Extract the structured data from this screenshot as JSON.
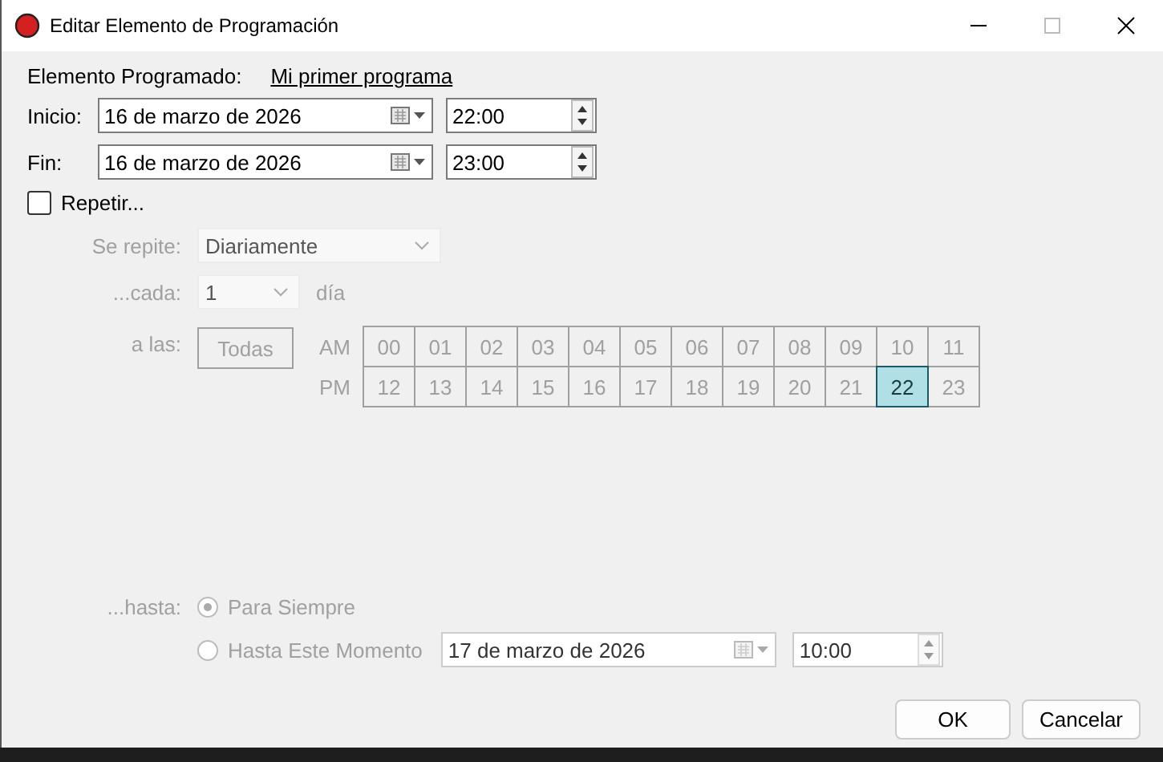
{
  "window": {
    "title": "Editar Elemento de Programación"
  },
  "program": {
    "label": "Elemento Programado:",
    "link": "Mi primer programa"
  },
  "start": {
    "label": "Inicio:",
    "date": "16 de marzo de 2026",
    "time": "22:00"
  },
  "end": {
    "label": "Fin:",
    "date": "16 de marzo de 2026",
    "time": "23:00"
  },
  "repeat": {
    "label": "Repetir...",
    "checked": false,
    "frequency": {
      "label": "Se repite:",
      "value": "Diariamente"
    },
    "every": {
      "label": "...cada:",
      "value": "1",
      "unit": "día"
    },
    "at": {
      "label": "a las:",
      "all_button": "Todas",
      "am_label": "AM",
      "pm_label": "PM",
      "am": [
        {
          "label": "00",
          "selected": false
        },
        {
          "label": "01",
          "selected": false
        },
        {
          "label": "02",
          "selected": false
        },
        {
          "label": "03",
          "selected": false
        },
        {
          "label": "04",
          "selected": false
        },
        {
          "label": "05",
          "selected": false
        },
        {
          "label": "06",
          "selected": false
        },
        {
          "label": "07",
          "selected": false
        },
        {
          "label": "08",
          "selected": false
        },
        {
          "label": "09",
          "selected": false
        },
        {
          "label": "10",
          "selected": false
        },
        {
          "label": "11",
          "selected": false
        }
      ],
      "pm": [
        {
          "label": "12",
          "selected": false
        },
        {
          "label": "13",
          "selected": false
        },
        {
          "label": "14",
          "selected": false
        },
        {
          "label": "15",
          "selected": false
        },
        {
          "label": "16",
          "selected": false
        },
        {
          "label": "17",
          "selected": false
        },
        {
          "label": "18",
          "selected": false
        },
        {
          "label": "19",
          "selected": false
        },
        {
          "label": "20",
          "selected": false
        },
        {
          "label": "21",
          "selected": false
        },
        {
          "label": "22",
          "selected": true
        },
        {
          "label": "23",
          "selected": false
        }
      ]
    },
    "until": {
      "label": "...hasta:",
      "options": [
        {
          "label": "Para Siempre",
          "selected": true
        },
        {
          "label": "Hasta Este Momento",
          "selected": false
        }
      ],
      "date": "17 de marzo de 2026",
      "time": "10:00"
    }
  },
  "buttons": [
    "OK",
    "Cancelar"
  ]
}
